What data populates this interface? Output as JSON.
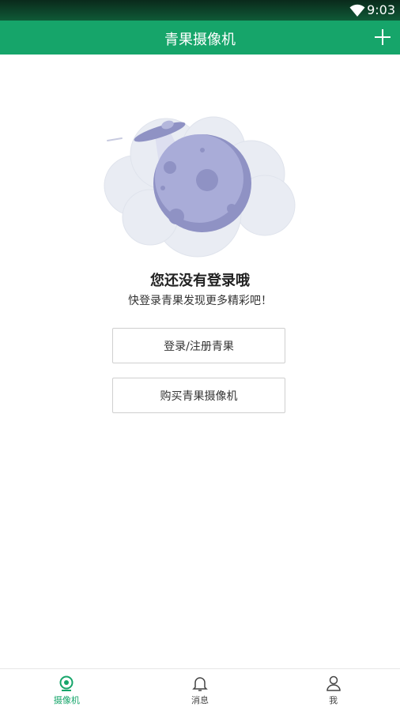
{
  "status_bar": {
    "time": "9:03"
  },
  "app_bar": {
    "title": "青果摄像机"
  },
  "empty_state": {
    "title": "您还没有登录哦",
    "subtitle": "快登录青果发现更多精彩吧！"
  },
  "actions": {
    "login_label": "登录/注册青果",
    "buy_label": "购买青果摄像机"
  },
  "tabs": [
    {
      "label": "摄像机",
      "icon": "camera-icon",
      "active": true
    },
    {
      "label": "消息",
      "icon": "bell-icon",
      "active": false
    },
    {
      "label": "我",
      "icon": "user-icon",
      "active": false
    }
  ],
  "colors": {
    "accent": "#16a56a",
    "moon": "#8f92c4",
    "cloud": "#e9ecf3"
  }
}
